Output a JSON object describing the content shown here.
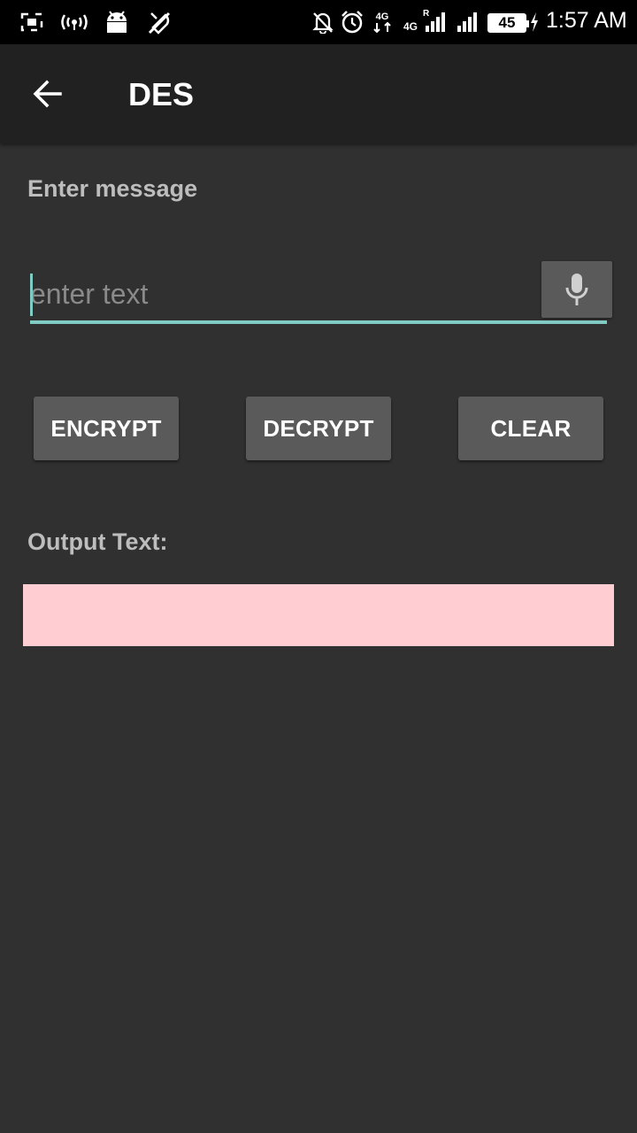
{
  "status_bar": {
    "time": "1:57 AM",
    "battery": "45",
    "network_1": "4G",
    "network_2": "4G",
    "roaming": "R",
    "icons": [
      "screenshot-icon",
      "hotspot-icon",
      "android-icon",
      "no-location-icon",
      "notifications-off-icon",
      "alarm-icon",
      "data-arrows-icon",
      "signal-icon",
      "signal-icon",
      "battery-icon",
      "charging-icon"
    ]
  },
  "app_bar": {
    "title": "DES",
    "back_icon": "arrow-back-icon"
  },
  "form": {
    "message_label": "Enter message",
    "input_placeholder": "enter text",
    "input_value": "",
    "mic_icon": "microphone-icon"
  },
  "actions": {
    "encrypt_label": "ENCRYPT",
    "decrypt_label": "DECRYPT",
    "clear_label": "CLEAR"
  },
  "output": {
    "label": "Output Text:",
    "value": ""
  },
  "colors": {
    "background": "#303030",
    "app_bar": "#212121",
    "accent": "#80cbc4",
    "button": "#5a5a5a",
    "output_bg": "#ffcdd2"
  }
}
